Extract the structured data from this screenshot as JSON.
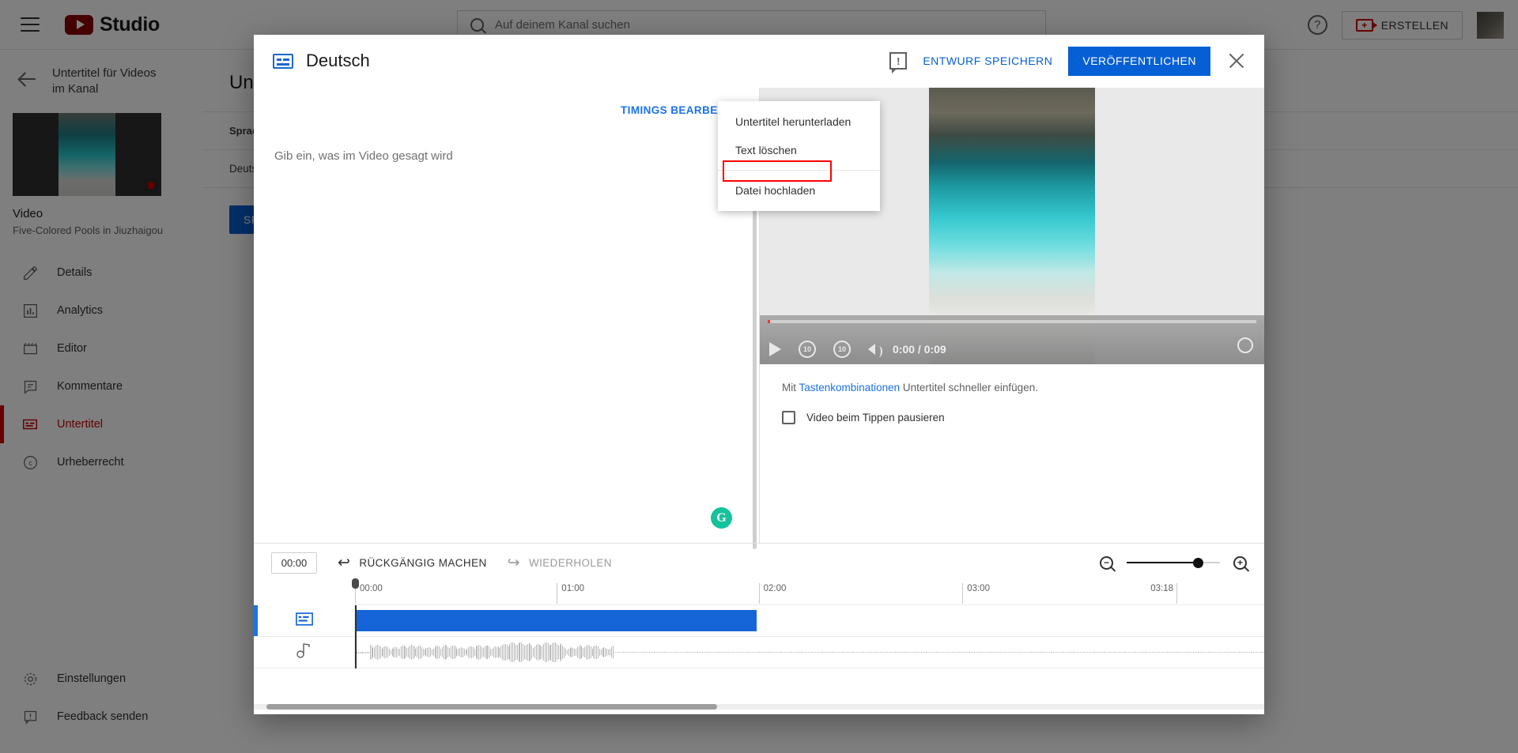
{
  "topbar": {
    "menu_icon": "hamburger-icon",
    "brand": "Studio",
    "search_placeholder": "Auf deinem Kanal suchen",
    "help_icon": "?",
    "create_label": "ERSTELLEN",
    "create_icon": "video-plus-icon"
  },
  "sidebar": {
    "back_title": "Untertitel für Videos im Kanal",
    "video_kind": "Video",
    "video_name": "Five-Colored Pools in Jiuzhaigou",
    "items": [
      {
        "label": "Details",
        "icon": "pencil-icon",
        "active": false
      },
      {
        "label": "Analytics",
        "icon": "bar-chart-icon",
        "active": false
      },
      {
        "label": "Editor",
        "icon": "clapperboard-icon",
        "active": false
      },
      {
        "label": "Kommentare",
        "icon": "comment-icon",
        "active": false
      },
      {
        "label": "Untertitel",
        "icon": "subtitles-icon",
        "active": true
      },
      {
        "label": "Urheberrecht",
        "icon": "copyright-icon",
        "active": false
      }
    ],
    "bottom_items": [
      {
        "label": "Einstellungen",
        "icon": "gear-icon"
      },
      {
        "label": "Feedback senden",
        "icon": "feedback-icon"
      }
    ]
  },
  "page": {
    "title": "Untertitel",
    "table_header": "Sprache",
    "table_row": "Deutsch",
    "speech_button": "SPRACHE HINZUFÜGEN"
  },
  "dialog": {
    "icon": "subtitles-icon",
    "title": "Deutsch",
    "feedback_icon": "feedback-icon",
    "save_draft_label": "ENTWURF SPEICHERN",
    "publish_label": "VERÖFFENTLICHEN",
    "close_icon": "close-icon",
    "editor": {
      "timings_label": "TIMINGS BEARBEITEN",
      "placeholder": "Gib ein, was im Video gesagt wird",
      "grammarly_badge": "G"
    },
    "menu": {
      "items": [
        {
          "label": "Untertitel herunterladen",
          "highlighted": false
        },
        {
          "label": "Text löschen",
          "highlighted": false
        },
        {
          "label": "Datei hochladen",
          "highlighted": true
        }
      ],
      "highlight_color": "#ff0000"
    },
    "player": {
      "play_icon": "play-icon",
      "rewind_icon": "replay-10-icon",
      "forward_icon": "forward-10-icon",
      "volume_icon": "volume-icon",
      "time": "0:00 / 0:09",
      "settings_icon": "gear-icon"
    },
    "hint_prefix": "Mit ",
    "hint_link": "Tastenkombinationen",
    "hint_suffix": " Untertitel schneller einfügen.",
    "checkbox_label": "Video beim Tippen pausieren",
    "checkbox_checked": false
  },
  "timeline": {
    "timecode": "00:00",
    "undo_label": "RÜCKGÄNGIG MACHEN",
    "redo_label": "WIEDERHOLEN",
    "zoom_out_icon": "zoom-out-icon",
    "zoom_in_icon": "zoom-in-icon",
    "zoom_value": 74,
    "ticks": [
      {
        "label": "00:00",
        "pos": 0
      },
      {
        "label": "01:00",
        "pos": 28.5
      },
      {
        "label": "02:00",
        "pos": 57
      },
      {
        "label": "03:00",
        "pos": 85.5
      },
      {
        "label": "03:18",
        "pos": 97.5
      }
    ],
    "tracks": [
      {
        "icon": "subtitles-icon",
        "selected": true,
        "kind": "cue"
      },
      {
        "icon": "music-note-icon",
        "selected": false,
        "kind": "waveform"
      }
    ]
  },
  "colors": {
    "accent_blue": "#065fd4",
    "link_blue": "#1a73e8",
    "youtube_red": "#c00000",
    "highlight_red": "#ff0000",
    "cue_blue": "#1565d8"
  }
}
